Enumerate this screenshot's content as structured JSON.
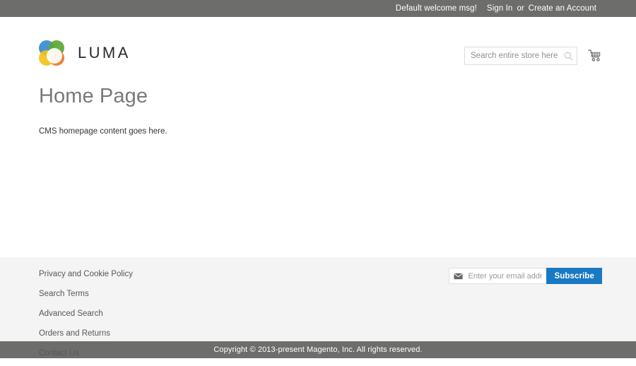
{
  "top_panel": {
    "welcome_message": "Default welcome msg!",
    "sign_in_label": "Sign In",
    "separator": "or",
    "create_account_label": "Create an Account"
  },
  "header": {
    "logo_text": "LUMA",
    "logo_icon": "luma-flower-logo",
    "search": {
      "value": "",
      "placeholder": "Search entire store here...",
      "search_icon": "search-icon"
    },
    "cart_icon": "shopping-cart-icon"
  },
  "main": {
    "page_title": "Home Page",
    "cms_content": "CMS homepage content goes here."
  },
  "footer": {
    "links": [
      {
        "label": "Privacy and Cookie Policy"
      },
      {
        "label": "Search Terms"
      },
      {
        "label": "Advanced Search"
      },
      {
        "label": "Orders and Returns"
      },
      {
        "label": "Contact Us"
      }
    ],
    "newsletter": {
      "envelope_icon": "envelope-icon",
      "email_value": "",
      "email_placeholder": "Enter your email address",
      "subscribe_label": "Subscribe"
    }
  },
  "copyright": {
    "text": "Copyright © 2013-present Magento, Inc. All rights reserved."
  },
  "colors": {
    "top_bar": "#6d6e6c",
    "footer_bg": "#f4f4f4",
    "accent_blue": "#1979c3",
    "page_title": "#797979",
    "logo_blue": "#3a8ccc",
    "logo_green": "#5aa832",
    "logo_orange": "#e8772b",
    "logo_yellow": "#f0c419"
  }
}
